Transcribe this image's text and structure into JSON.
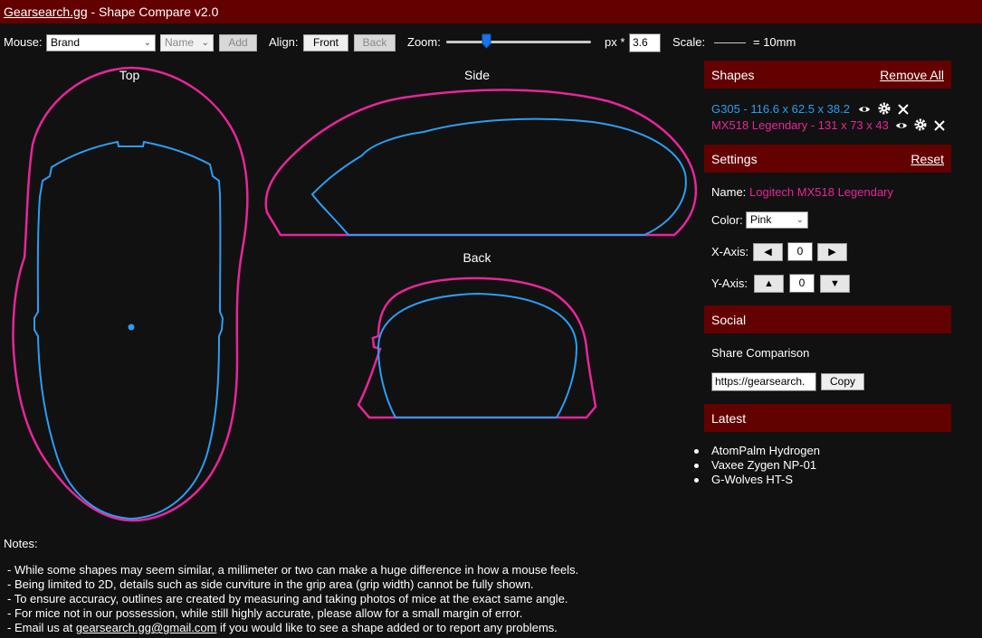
{
  "titlebar": {
    "site": "Gearsearch.gg",
    "rest": " - Shape Compare v2.0"
  },
  "toolbar": {
    "mouse_label": "Mouse:",
    "brand_select": "Brand",
    "name_select": "Name",
    "add_label": "Add",
    "align_label": "Align:",
    "front_label": "Front",
    "back_label": "Back",
    "zoom_label": "Zoom:",
    "zoom_level": 0.28,
    "px_label": "px *",
    "px_value": "3.6",
    "scale_label": "Scale:",
    "scale_value": "= 10mm"
  },
  "views": {
    "top": "Top",
    "side": "Side",
    "back": "Back"
  },
  "colors": {
    "blue": "#2b9df4",
    "pink": "#e8259a",
    "header": "#630000",
    "background": "#111111"
  },
  "shapes_panel": {
    "title": "Shapes",
    "remove_all": "Remove All",
    "items": [
      {
        "label": "G305 - 116.6 x 62.5 x 38.2",
        "color": "#2b9df4"
      },
      {
        "label": "MX518 Legendary - 131 x 73 x 43",
        "color": "#e8259a"
      }
    ]
  },
  "settings_panel": {
    "title": "Settings",
    "reset": "Reset",
    "name_label": "Name:",
    "name_value": "Logitech MX518 Legendary",
    "color_label": "Color:",
    "color_value": "Pink",
    "x_label": "X-Axis:",
    "x_value": "0",
    "y_label": "Y-Axis:",
    "y_value": "0"
  },
  "social_panel": {
    "title": "Social",
    "share_label": "Share Comparison",
    "url": "https://gearsearch.",
    "copy": "Copy"
  },
  "latest_panel": {
    "title": "Latest",
    "items": [
      "AtomPalm Hydrogen",
      "Vaxee Zygen NP-01",
      "G-Wolves HT-S"
    ]
  },
  "notes": {
    "title": "Notes:",
    "lines": [
      "- While some shapes may seem similar, a millimeter or two can make a huge difference in how a mouse feels.",
      "- Being limited to 2D, details such as side curviture in the grip area (grip width) cannot be fully shown.",
      "- To ensure accuracy, outlines are created by measuring and taking photos of mice at the exact same angle.",
      "- For mice not in our possession, while still highly accurate, please allow for a small margin of error."
    ],
    "email_prefix": "- Email us at ",
    "email": "gearsearch.gg@gmail.com",
    "email_suffix": " if you would like to see a shape added or to report any problems."
  }
}
